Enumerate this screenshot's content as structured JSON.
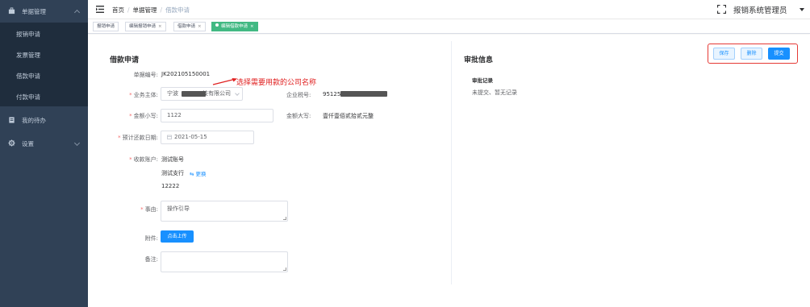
{
  "sidebar": {
    "group1": {
      "label": "单据管理",
      "icon": "briefcase-icon"
    },
    "subitems": [
      "报销申请",
      "发票管理",
      "借款申请",
      "付款申请"
    ],
    "group2": {
      "label": "我的待办",
      "icon": "clipboard-icon"
    },
    "group3": {
      "label": "设置",
      "icon": "gear-icon"
    }
  },
  "header": {
    "breadcrumb": [
      "首页",
      "单据管理",
      "借款申请"
    ],
    "user": "报销系统管理员"
  },
  "tags": [
    {
      "label": "报销申请",
      "closable": false
    },
    {
      "label": "编辑报销申请",
      "closable": true
    },
    {
      "label": "借款申请",
      "closable": true
    },
    {
      "label": "编辑借款申请",
      "closable": true,
      "active": true
    }
  ],
  "tag_close_glyph": "×",
  "form": {
    "title": "借款申请",
    "doc_no_label": "单据编号:",
    "doc_no": "JK202105150001",
    "entity_label": "业务主体:",
    "entity_prefix": "宁波",
    "entity_suffix": "技有限公司",
    "tax_label": "企业税号:",
    "tax_prefix": "95125",
    "amount_label": "金额小写:",
    "amount": "1122",
    "amount_upper_label": "金额大写:",
    "amount_upper": "壹仟壹佰贰拾贰元整",
    "date_label": "预计还款日期:",
    "date": "2021-05-15",
    "account_label": "收款账户:",
    "account_name": "测试账号",
    "account_bank": "测试支行",
    "change_link": "更换",
    "account_no": "12222",
    "reason_label": "事由:",
    "reason_placeholder": "操作引导",
    "attach_label": "附件:",
    "upload_button": "点击上传",
    "remark_label": "备注:"
  },
  "annotation": "选择需要用款的公司名称",
  "approval": {
    "title": "审批信息",
    "records_title": "审批记录",
    "records_empty": "未提交、暂无记录"
  },
  "actions": {
    "save": "保存",
    "delete": "删除",
    "submit": "提交"
  },
  "colors": {
    "sidebar_bg": "#304156",
    "submenu_bg": "#1f2d3d",
    "primary": "#1890ff",
    "active_tag": "#42b983",
    "required": "#f56c6c",
    "annotation": "#e02020"
  }
}
